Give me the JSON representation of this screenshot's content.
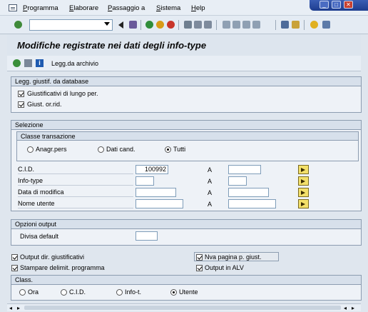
{
  "menu": {
    "items": [
      "Programma",
      "Elaborare",
      "Passaggio a",
      "Sistema",
      "Help"
    ]
  },
  "toolbar": {
    "command_value": ""
  },
  "page": {
    "title": "Modifiche registrate nei dati degli info-type"
  },
  "app_toolbar": {
    "read_archive_label": "Legg.da archivio"
  },
  "frame_db": {
    "title": "Legg. giustif. da database",
    "long_term_label": "Giustificativi di lungo per.",
    "reduced_label": "Giust. or.rid."
  },
  "frame_selection": {
    "title": "Selezione",
    "transaction_class": {
      "title": "Classe transazione",
      "options": [
        "Anagr.pers",
        "Dati cand.",
        "Tutti"
      ],
      "selected": "Tutti"
    },
    "fields": [
      {
        "label": "C.I.D.",
        "from": "100992",
        "to_label": "A",
        "to": ""
      },
      {
        "label": "Info-type",
        "from": "",
        "to_label": "A",
        "to": ""
      },
      {
        "label": "Data di modifica",
        "from": "",
        "to_label": "A",
        "to": ""
      },
      {
        "label": "Nome utente",
        "from": "",
        "to_label": "A",
        "to": ""
      }
    ]
  },
  "frame_output": {
    "title": "Opzioni output",
    "currency_label": "Divisa default",
    "currency_value": ""
  },
  "options": {
    "output_justif": "Output dir. giustificativi",
    "new_page": "Nva pagina p. giust.",
    "print_limits": "Stampare delimit. programma",
    "output_alv": "Output in ALV"
  },
  "frame_class": {
    "title": "Class.",
    "options": [
      "Ora",
      "C.I.D.",
      "Info-t.",
      "Utente"
    ],
    "selected": "Utente"
  },
  "colors": {
    "accent": "#1d3d8e",
    "background": "#dfe6ee",
    "multiselect": "#f3e06a"
  }
}
